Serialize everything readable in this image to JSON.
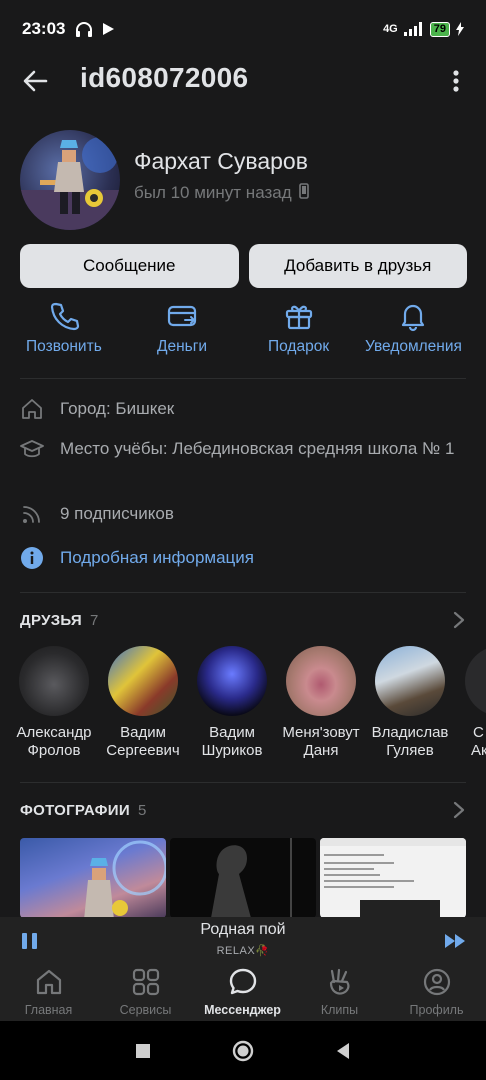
{
  "status_bar": {
    "time": "23:03",
    "network": "4G",
    "battery": "79"
  },
  "header": {
    "title": "id608072006"
  },
  "profile": {
    "name": "Фархат Суваров",
    "last_seen": "был 10 минут назад",
    "message_button": "Сообщение",
    "add_friend_button": "Добавить в друзья"
  },
  "actions": {
    "call": "Позвонить",
    "money": "Деньги",
    "gift": "Подарок",
    "notifications": "Уведомления"
  },
  "info": {
    "city": "Город: Бишкек",
    "education": "Место учёбы: Лебединовская средняя школа № 1",
    "followers": "9 подписчиков",
    "details_link": "Подробная информация"
  },
  "friends": {
    "title": "ДРУЗЬЯ",
    "count": "7",
    "items": [
      {
        "first": "Александр",
        "last": "Фролов"
      },
      {
        "first": "Вадим",
        "last": "Сергеевич"
      },
      {
        "first": "Вадим",
        "last": "Шуриков"
      },
      {
        "first": "Меня'зовут",
        "last": "Даня"
      },
      {
        "first": "Владислав",
        "last": "Гуляев"
      },
      {
        "first": "С",
        "last": "Ак"
      }
    ]
  },
  "photos": {
    "title": "ФОТОГРАФИИ",
    "count": "5"
  },
  "player": {
    "track": "Родная пой",
    "artist": "RELAX🥀"
  },
  "tabs": [
    {
      "label": "Главная",
      "icon": "home-icon"
    },
    {
      "label": "Сервисы",
      "icon": "services-icon"
    },
    {
      "label": "Мессенджер",
      "icon": "messenger-icon"
    },
    {
      "label": "Клипы",
      "icon": "clips-icon"
    },
    {
      "label": "Профиль",
      "icon": "profile-icon"
    }
  ],
  "colors": {
    "accent": "#71aaeb",
    "background": "#19191a",
    "button": "#e1e3e6"
  }
}
